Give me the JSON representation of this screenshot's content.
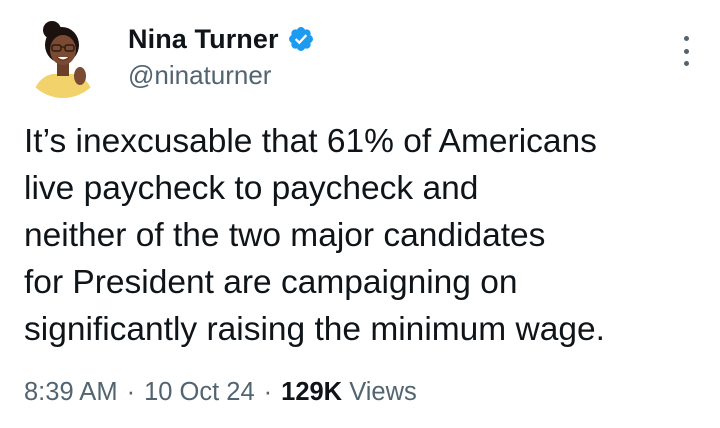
{
  "author": {
    "name": "Nina Turner",
    "handle": "@ninaturner",
    "verified": true
  },
  "tweet": {
    "lines": [
      "It’s inexcusable that 61% of Americans",
      "live paycheck to paycheck and",
      "neither of the two major candidates",
      "for President are campaigning on",
      "significantly raising the minimum wage."
    ]
  },
  "meta": {
    "time": "8:39 AM",
    "separator": "·",
    "date": "10 Oct 24",
    "views_count": "129K",
    "views_label": "Views"
  },
  "icons": {
    "verified": "verified-badge-icon",
    "more": "more-options-icon"
  },
  "colors": {
    "text": "#0f1419",
    "secondary": "#536471",
    "verified_blue": "#1d9bf0"
  }
}
